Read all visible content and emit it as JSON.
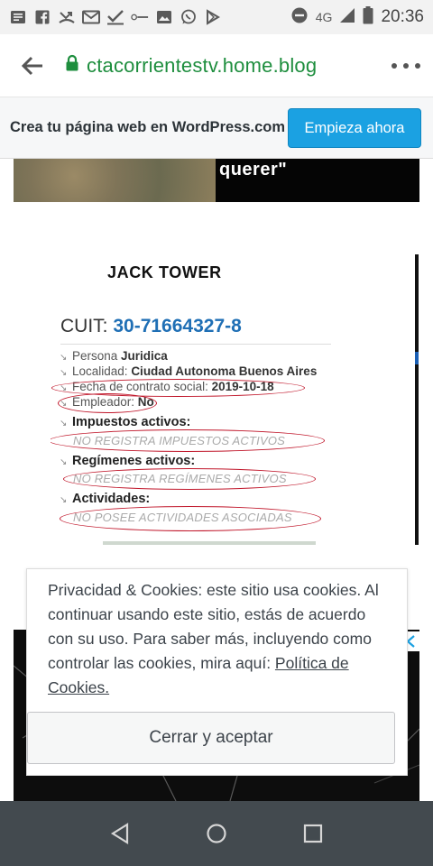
{
  "status_bar": {
    "icons": [
      "newspaper-icon",
      "facebook-icon",
      "missed-call-icon",
      "gmail-icon",
      "check-icon",
      "app-logo-icon",
      "image-icon",
      "whatsapp-icon",
      "play-store-icon"
    ],
    "network": "4G",
    "time": "20:36"
  },
  "browser": {
    "url": "ctacorrientestv.home.blog",
    "lock_color": "#1e8e3e",
    "url_color": "#1e8e3e"
  },
  "wordpress_banner": {
    "text": "Crea tu página web en WordPress.com",
    "button": "Empieza ahora",
    "button_color": "#1ba1e2"
  },
  "top_image": {
    "caption": "querer\""
  },
  "afip_card": {
    "title": "JACK TOWER",
    "cuit_label": "CUIT: ",
    "cuit_number": "30-71664327-8",
    "rows": [
      {
        "label": "Persona ",
        "value": "Juridica"
      },
      {
        "label": "Localidad: ",
        "value": "Ciudad Autonoma Buenos Aires"
      },
      {
        "label": "Fecha de contrato social: ",
        "value": "2019-10-18"
      },
      {
        "label": "Empleador: ",
        "value": "No"
      }
    ],
    "sections": [
      {
        "heading": "Impuestos activos:",
        "note": "NO REGISTRA IMPUESTOS ACTIVOS"
      },
      {
        "heading": "Regímenes activos:",
        "note": "NO REGISTRA REGÍMENES ACTIVOS"
      },
      {
        "heading": "Actividades:",
        "note": "NO POSEE ACTIVIDADES ASOCIADAS"
      }
    ],
    "highlight_color": "#c0162a",
    "cuit_color": "#1f6fb5"
  },
  "cookie_banner": {
    "text": "Privacidad & Cookies: este sitio usa cookies. Al continuar usando este sitio, estás de acuerdo con su uso. Para saber más, incluyendo como controlar las cookies, mira aquí: ",
    "link": "Política de Cookies.",
    "button": "Cerrar y aceptar"
  },
  "nav_bar": {
    "buttons": [
      "back-triangle-icon",
      "home-circle-icon",
      "recents-square-icon"
    ]
  }
}
